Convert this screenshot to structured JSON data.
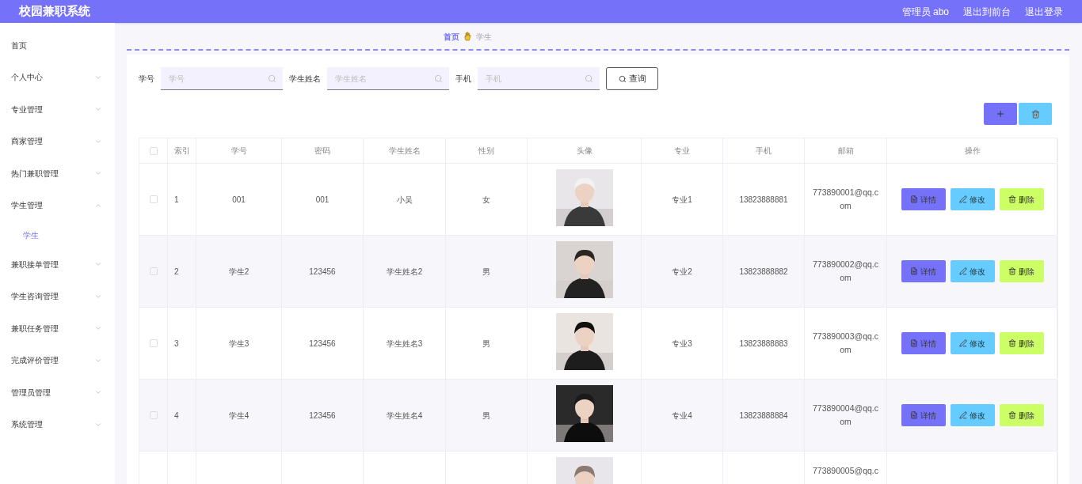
{
  "header": {
    "title": "校园兼职系统",
    "links": [
      "管理员 abo",
      "退出到前台",
      "退出登录"
    ]
  },
  "sidebar": {
    "items": [
      {
        "label": "首页",
        "kind": "link"
      },
      {
        "label": "个人中心",
        "kind": "menu",
        "expanded": false
      },
      {
        "label": "专业管理",
        "kind": "menu",
        "expanded": false
      },
      {
        "label": "商家管理",
        "kind": "menu",
        "expanded": false
      },
      {
        "label": "热门兼职管理",
        "kind": "menu",
        "expanded": false
      },
      {
        "label": "学生管理",
        "kind": "menu",
        "expanded": true,
        "children": [
          {
            "label": "学生",
            "selected": true
          }
        ]
      },
      {
        "label": "兼职接单管理",
        "kind": "menu",
        "expanded": false
      },
      {
        "label": "学生咨询管理",
        "kind": "menu",
        "expanded": false
      },
      {
        "label": "兼职任务管理",
        "kind": "menu",
        "expanded": false
      },
      {
        "label": "完成评价管理",
        "kind": "menu",
        "expanded": false
      },
      {
        "label": "管理员管理",
        "kind": "menu",
        "expanded": false
      },
      {
        "label": "系统管理",
        "kind": "menu",
        "expanded": false
      }
    ]
  },
  "breadcrumb": [
    {
      "label": "首页",
      "kind": "link"
    },
    {
      "label": "学生",
      "kind": "current"
    }
  ],
  "search": {
    "fields": [
      {
        "label": "学号",
        "placeholder": "学号"
      },
      {
        "label": "学生姓名",
        "placeholder": "学生姓名"
      },
      {
        "label": "手机",
        "placeholder": "手机"
      }
    ],
    "button": "查询"
  },
  "table": {
    "select_all": {
      "checked": false
    },
    "columns": [
      "索引",
      "学号",
      "密码",
      "学生姓名",
      "性别",
      "头像",
      "专业",
      "手机",
      "邮箱",
      "操作"
    ],
    "rows": [
      {
        "checked": false,
        "index": "1",
        "student_id": "001",
        "password": "001",
        "name": "小吴",
        "gender": "女",
        "major": "专业1",
        "phone": "13823888881",
        "email": "773890001@qq.com",
        "actions": [
          "详情",
          "修改",
          "删除"
        ]
      },
      {
        "checked": false,
        "index": "2",
        "student_id": "学生2",
        "password": "123456",
        "name": "学生姓名2",
        "gender": "男",
        "major": "专业2",
        "phone": "13823888882",
        "email": "773890002@qq.com",
        "actions": [
          "详情",
          "修改",
          "删除"
        ]
      },
      {
        "checked": false,
        "index": "3",
        "student_id": "学生3",
        "password": "123456",
        "name": "学生姓名3",
        "gender": "男",
        "major": "专业3",
        "phone": "13823888883",
        "email": "773890003@qq.com",
        "actions": [
          "详情",
          "修改",
          "删除"
        ]
      },
      {
        "checked": false,
        "index": "4",
        "student_id": "学生4",
        "password": "123456",
        "name": "学生姓名4",
        "gender": "男",
        "major": "专业4",
        "phone": "13823888884",
        "email": "773890004@qq.com",
        "actions": [
          "详情",
          "修改",
          "删除"
        ]
      },
      {
        "email": "773890005@qq.c"
      }
    ]
  }
}
